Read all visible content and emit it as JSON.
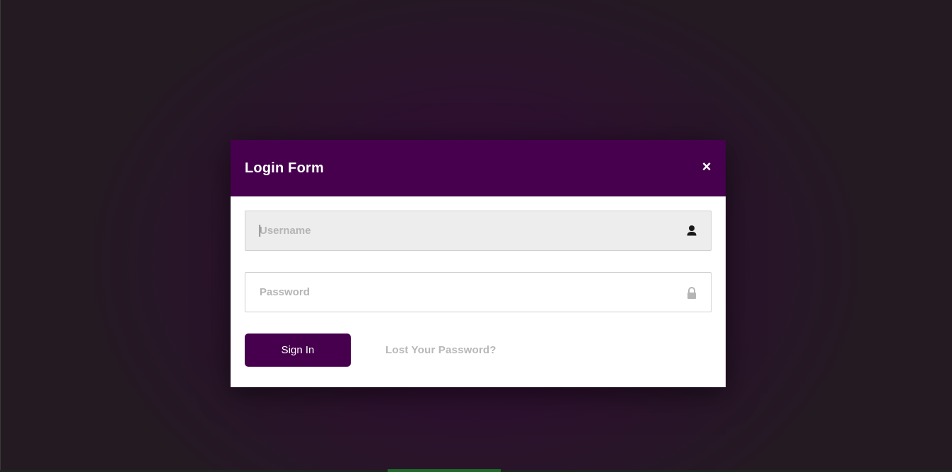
{
  "modal": {
    "title": "Login Form",
    "close_label": "×"
  },
  "form": {
    "username": {
      "value": "",
      "placeholder": "Username",
      "icon": "user-icon"
    },
    "password": {
      "value": "",
      "placeholder": "Password",
      "icon": "lock-icon"
    },
    "sign_in_label": "Sign In",
    "lost_password_label": "Lost Your Password?"
  },
  "colors": {
    "accent": "#46004d",
    "placeholder": "#b5b5b5",
    "link": "#b8b8b8"
  }
}
